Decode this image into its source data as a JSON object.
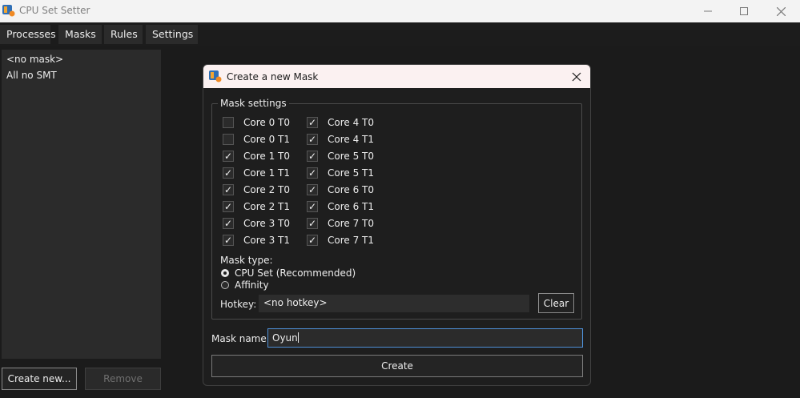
{
  "window": {
    "title": "CPU Set Setter"
  },
  "menu": {
    "items": [
      "Processes",
      "Masks",
      "Rules",
      "Settings"
    ]
  },
  "mask_list": {
    "items": [
      "<no mask>",
      "All no SMT"
    ]
  },
  "buttons": {
    "create_new": "Create new...",
    "remove": "Remove"
  },
  "dialog": {
    "title": "Create a new Mask",
    "group_label": "Mask settings",
    "cores_left": [
      {
        "label": "Core 0 T0",
        "checked": false
      },
      {
        "label": "Core 0 T1",
        "checked": false
      },
      {
        "label": "Core 1 T0",
        "checked": true
      },
      {
        "label": "Core 1 T1",
        "checked": true
      },
      {
        "label": "Core 2 T0",
        "checked": true
      },
      {
        "label": "Core 2 T1",
        "checked": true
      },
      {
        "label": "Core 3 T0",
        "checked": true
      },
      {
        "label": "Core 3 T1",
        "checked": true
      }
    ],
    "cores_right": [
      {
        "label": "Core 4 T0",
        "checked": true
      },
      {
        "label": "Core 4 T1",
        "checked": true
      },
      {
        "label": "Core 5 T0",
        "checked": true
      },
      {
        "label": "Core 5 T1",
        "checked": true
      },
      {
        "label": "Core 6 T0",
        "checked": true
      },
      {
        "label": "Core 6 T1",
        "checked": true
      },
      {
        "label": "Core 7 T0",
        "checked": true
      },
      {
        "label": "Core 7 T1",
        "checked": true
      }
    ],
    "mask_type_label": "Mask type:",
    "mask_type_options": [
      "CPU Set (Recommended)",
      "Affinity"
    ],
    "mask_type_selected": "CPU Set (Recommended)",
    "hotkey_label": "Hotkey:",
    "hotkey_value": "<no hotkey>",
    "clear_label": "Clear",
    "mask_name_label": "Mask name:",
    "mask_name_value": "Oyun",
    "create_label": "Create"
  }
}
